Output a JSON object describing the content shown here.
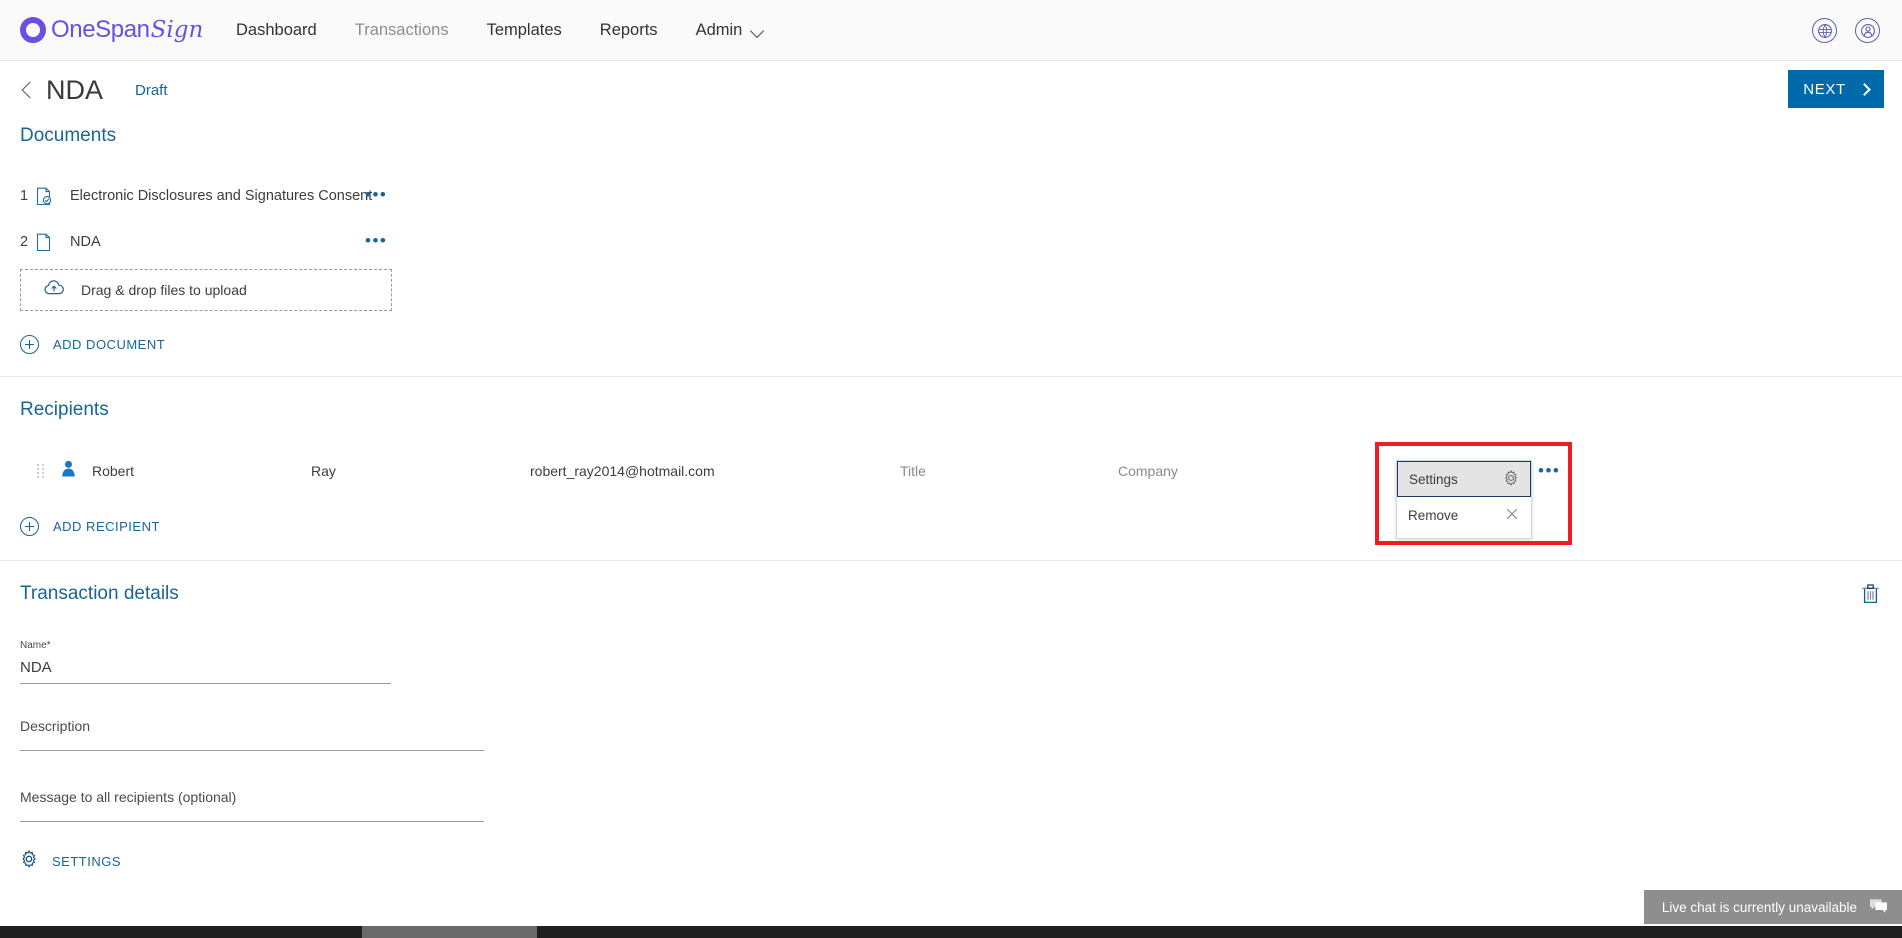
{
  "topnav": {
    "logo": {
      "name_main": "OneSpan",
      "name_script": "Sign",
      "color": "#6b4fe0"
    },
    "items": [
      {
        "label": "Dashboard",
        "state": "active"
      },
      {
        "label": "Transactions",
        "state": "muted"
      },
      {
        "label": "Templates",
        "state": "active"
      },
      {
        "label": "Reports",
        "state": "active"
      },
      {
        "label": "Admin",
        "state": "active",
        "has_caret": true
      }
    ],
    "right_icons": [
      {
        "name": "globe-icon"
      },
      {
        "name": "account-icon"
      }
    ]
  },
  "titlebar": {
    "back_icon": "chevron-left-icon",
    "title": "NDA",
    "status": "Draft",
    "next_label": "NEXT"
  },
  "documents": {
    "heading": "Documents",
    "items": [
      {
        "number": "1",
        "name": "Electronic Disclosures and Signatures Consent",
        "icon": "document-check-icon",
        "menu": "•••"
      },
      {
        "number": "2",
        "name": "NDA",
        "icon": "document-icon",
        "menu": "•••"
      }
    ],
    "dropzone_label": "Drag & drop files to upload",
    "dropzone_icon": "cloud-upload-icon",
    "add_label": "ADD DOCUMENT"
  },
  "recipients": {
    "heading": "Recipients",
    "columns": {
      "title_placeholder": "Title",
      "company_placeholder": "Company"
    },
    "rows": [
      {
        "first_name": "Robert",
        "last_name": "Ray",
        "email": "robert_ray2014@hotmail.com",
        "title": "Title",
        "company": "Company",
        "menu": "•••"
      }
    ],
    "menu_popup": {
      "items": [
        {
          "label": "Settings",
          "icon": "gear-icon",
          "selected": true
        },
        {
          "label": "Remove",
          "icon": "close-icon",
          "selected": false
        }
      ]
    },
    "annotation_color": "#ee1c25",
    "add_label": "ADD RECIPIENT"
  },
  "transaction": {
    "heading": "Transaction details",
    "delete_icon": "trash-icon",
    "name_field": {
      "label": "Name",
      "required_mark": "*",
      "value": "NDA"
    },
    "description_field": {
      "placeholder": "Description",
      "value": ""
    },
    "message_field": {
      "placeholder": "Message to all recipients (optional)",
      "value": ""
    },
    "settings_label": "SETTINGS"
  },
  "livechat": {
    "text": "Live chat is currently unavailable",
    "icon": "chat-icon"
  }
}
